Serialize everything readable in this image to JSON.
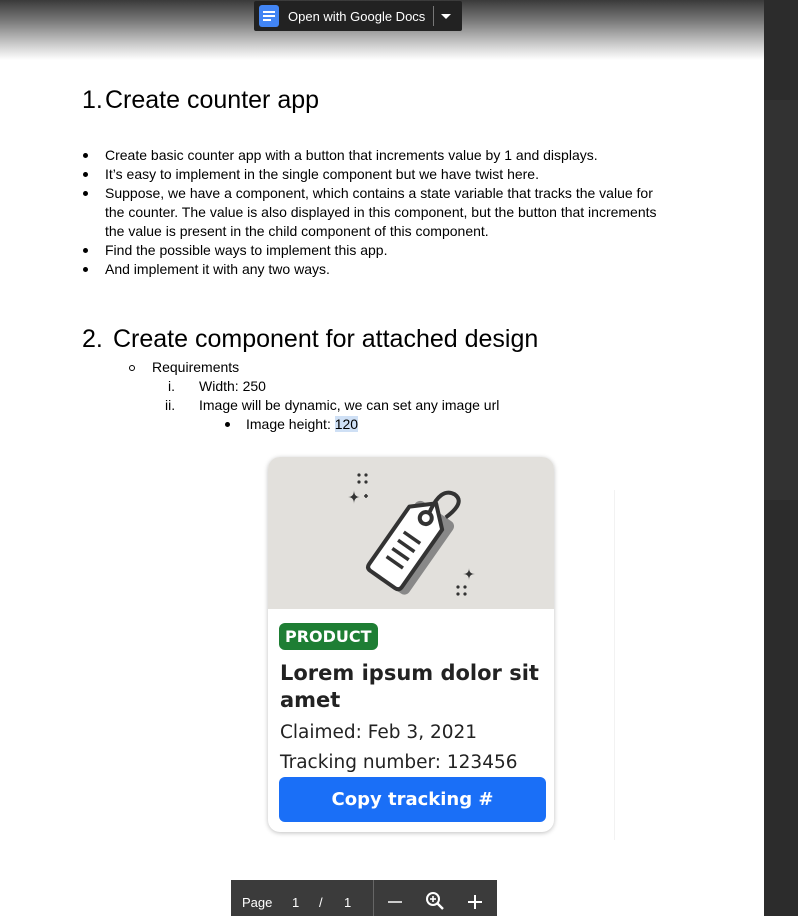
{
  "toolbar": {
    "open_with_label": "Open with Google Docs",
    "icon": "google-docs-icon"
  },
  "section1": {
    "number": "1.",
    "title": "Create counter app",
    "bullets": [
      "Create basic counter app with a button that increments value by 1 and displays.",
      "It’s easy to implement in the single component but we have twist here.",
      "Suppose, we have a component, which contains a state variable that tracks the value for the counter. The value is also displayed in this component, but the button that increments the value is present in the child component of this component.",
      "Find the possible ways to implement this app.",
      "And implement it with any two ways."
    ]
  },
  "section2": {
    "number": "2.",
    "title": "Create component for attached design",
    "requirements_label": "Requirements",
    "items": [
      {
        "marker": "i.",
        "text": "Width: 250"
      },
      {
        "marker": "ii.",
        "text": "Image will be dynamic, we can set any image url"
      }
    ],
    "sub_item_label": "Image height: ",
    "sub_item_value": "120"
  },
  "card": {
    "badge": "PRODUCT",
    "title": "Lorem ipsum dolor sit amet",
    "claimed": "Claimed: Feb 3, 2021",
    "tracking": "Tracking number: 123456",
    "button": "Copy tracking #",
    "image_icon": "price-tag-icon",
    "colors": {
      "badge": "#1e7e34",
      "button": "#1a6ff7",
      "image_bg": "#e2e0dc"
    }
  },
  "pager": {
    "page_label": "Page",
    "current": "1",
    "separator": "/",
    "total": "1"
  }
}
